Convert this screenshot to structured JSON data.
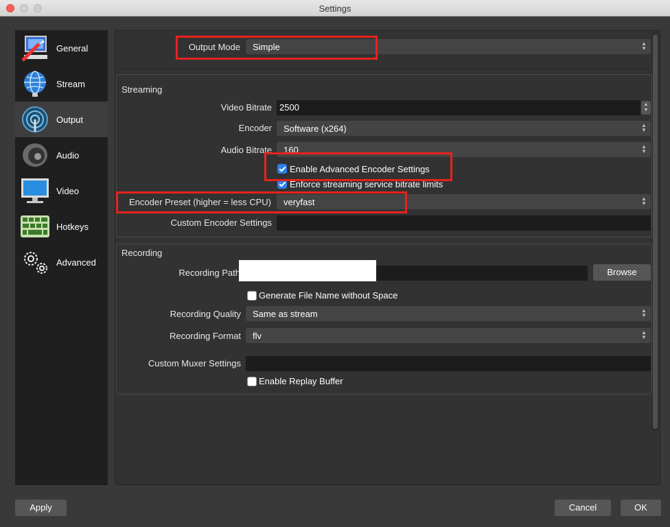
{
  "window": {
    "title": "Settings"
  },
  "sidebar": {
    "items": [
      {
        "label": "General",
        "icon": "general-icon"
      },
      {
        "label": "Stream",
        "icon": "globe-icon"
      },
      {
        "label": "Output",
        "icon": "broadcast-icon",
        "active": true
      },
      {
        "label": "Audio",
        "icon": "speaker-icon"
      },
      {
        "label": "Video",
        "icon": "monitor-icon"
      },
      {
        "label": "Hotkeys",
        "icon": "keyboard-icon"
      },
      {
        "label": "Advanced",
        "icon": "gears-icon"
      }
    ]
  },
  "output_mode": {
    "label": "Output Mode",
    "value": "Simple"
  },
  "streaming": {
    "title": "Streaming",
    "video_bitrate": {
      "label": "Video Bitrate",
      "value": "2500"
    },
    "encoder": {
      "label": "Encoder",
      "value": "Software (x264)"
    },
    "audio_bitrate": {
      "label": "Audio Bitrate",
      "value": "160"
    },
    "enable_advanced": {
      "label": "Enable Advanced Encoder Settings",
      "checked": true
    },
    "enforce_limits": {
      "label": "Enforce streaming service bitrate limits",
      "checked": true
    },
    "encoder_preset": {
      "label": "Encoder Preset (higher = less CPU)",
      "value": "veryfast"
    },
    "custom_encoder": {
      "label": "Custom Encoder Settings",
      "value": ""
    }
  },
  "recording": {
    "title": "Recording",
    "path": {
      "label": "Recording Path",
      "value": "",
      "browse_label": "Browse"
    },
    "gen_filename": {
      "label": "Generate File Name without Space",
      "checked": false
    },
    "quality": {
      "label": "Recording Quality",
      "value": "Same as stream"
    },
    "format": {
      "label": "Recording Format",
      "value": "flv"
    },
    "custom_muxer": {
      "label": "Custom Muxer Settings",
      "value": ""
    },
    "replay_buffer": {
      "label": "Enable Replay Buffer",
      "checked": false
    }
  },
  "footer": {
    "apply": "Apply",
    "cancel": "Cancel",
    "ok": "OK"
  },
  "colors": {
    "highlight": "#e8221c",
    "accent": "#2e7fe8",
    "sidebar_bg": "#1f1f1f"
  }
}
